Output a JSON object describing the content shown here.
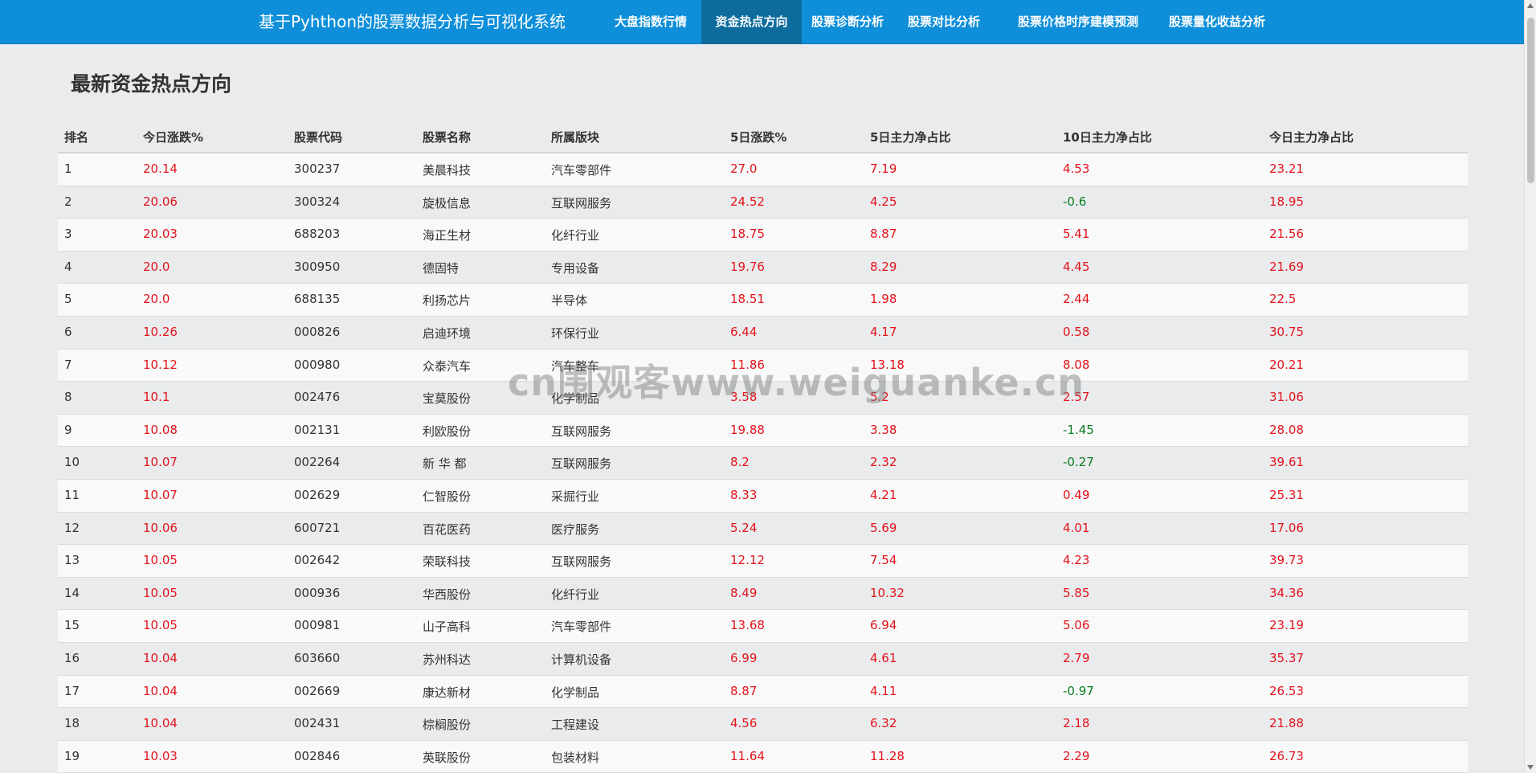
{
  "brand": "基于Pyhthon的股票数据分析与可视化系统",
  "nav": [
    "大盘指数行情",
    "资金热点方向",
    "股票诊断分析",
    "股票对比分析",
    "股票价格时序建模预测",
    "股票量化收益分析"
  ],
  "active_nav": "资金热点方向",
  "page_title": "最新资金热点方向",
  "columns": [
    "排名",
    "今日涨跌%",
    "股票代码",
    "股票名称",
    "所属版块",
    "5日涨跌%",
    "5日主力净占比",
    "10日主力净占比",
    "今日主力净占比"
  ],
  "rows": [
    [
      "1",
      "20.14",
      "300237",
      "美晨科技",
      "汽车零部件",
      "27.0",
      "7.19",
      "4.53",
      "23.21"
    ],
    [
      "2",
      "20.06",
      "300324",
      "旋极信息",
      "互联网服务",
      "24.52",
      "4.25",
      "-0.6",
      "18.95"
    ],
    [
      "3",
      "20.03",
      "688203",
      "海正生材",
      "化纤行业",
      "18.75",
      "8.87",
      "5.41",
      "21.56"
    ],
    [
      "4",
      "20.0",
      "300950",
      "德固特",
      "专用设备",
      "19.76",
      "8.29",
      "4.45",
      "21.69"
    ],
    [
      "5",
      "20.0",
      "688135",
      "利扬芯片",
      "半导体",
      "18.51",
      "1.98",
      "2.44",
      "22.5"
    ],
    [
      "6",
      "10.26",
      "000826",
      "启迪环境",
      "环保行业",
      "6.44",
      "4.17",
      "0.58",
      "30.75"
    ],
    [
      "7",
      "10.12",
      "000980",
      "众泰汽车",
      "汽车整车",
      "11.86",
      "13.18",
      "8.08",
      "20.21"
    ],
    [
      "8",
      "10.1",
      "002476",
      "宝莫股份",
      "化学制品",
      "3.58",
      "5.2",
      "2.57",
      "31.06"
    ],
    [
      "9",
      "10.08",
      "002131",
      "利欧股份",
      "互联网服务",
      "19.88",
      "3.38",
      "-1.45",
      "28.08"
    ],
    [
      "10",
      "10.07",
      "002264",
      "新 华 都",
      "互联网服务",
      "8.2",
      "2.32",
      "-0.27",
      "39.61"
    ],
    [
      "11",
      "10.07",
      "002629",
      "仁智股份",
      "采掘行业",
      "8.33",
      "4.21",
      "0.49",
      "25.31"
    ],
    [
      "12",
      "10.06",
      "600721",
      "百花医药",
      "医疗服务",
      "5.24",
      "5.69",
      "4.01",
      "17.06"
    ],
    [
      "13",
      "10.05",
      "002642",
      "荣联科技",
      "互联网服务",
      "12.12",
      "7.54",
      "4.23",
      "39.73"
    ],
    [
      "14",
      "10.05",
      "000936",
      "华西股份",
      "化纤行业",
      "8.49",
      "10.32",
      "5.85",
      "34.36"
    ],
    [
      "15",
      "10.05",
      "000981",
      "山子高科",
      "汽车零部件",
      "13.68",
      "6.94",
      "5.06",
      "23.19"
    ],
    [
      "16",
      "10.04",
      "603660",
      "苏州科达",
      "计算机设备",
      "6.99",
      "4.61",
      "2.79",
      "35.37"
    ],
    [
      "17",
      "10.04",
      "002669",
      "康达新材",
      "化学制品",
      "8.87",
      "4.11",
      "-0.97",
      "26.53"
    ],
    [
      "18",
      "10.04",
      "002431",
      "棕榈股份",
      "工程建设",
      "4.56",
      "6.32",
      "2.18",
      "21.88"
    ],
    [
      "19",
      "10.03",
      "002846",
      "英联股份",
      "包装材料",
      "11.64",
      "11.28",
      "2.29",
      "26.73"
    ]
  ],
  "colors": {
    "navbar": "#0f8fd9",
    "nav_active": "#0d6b9d",
    "up": "#e3141c",
    "down": "#0a7d22"
  },
  "watermark": "cn围观客www.weiguanke.cn"
}
